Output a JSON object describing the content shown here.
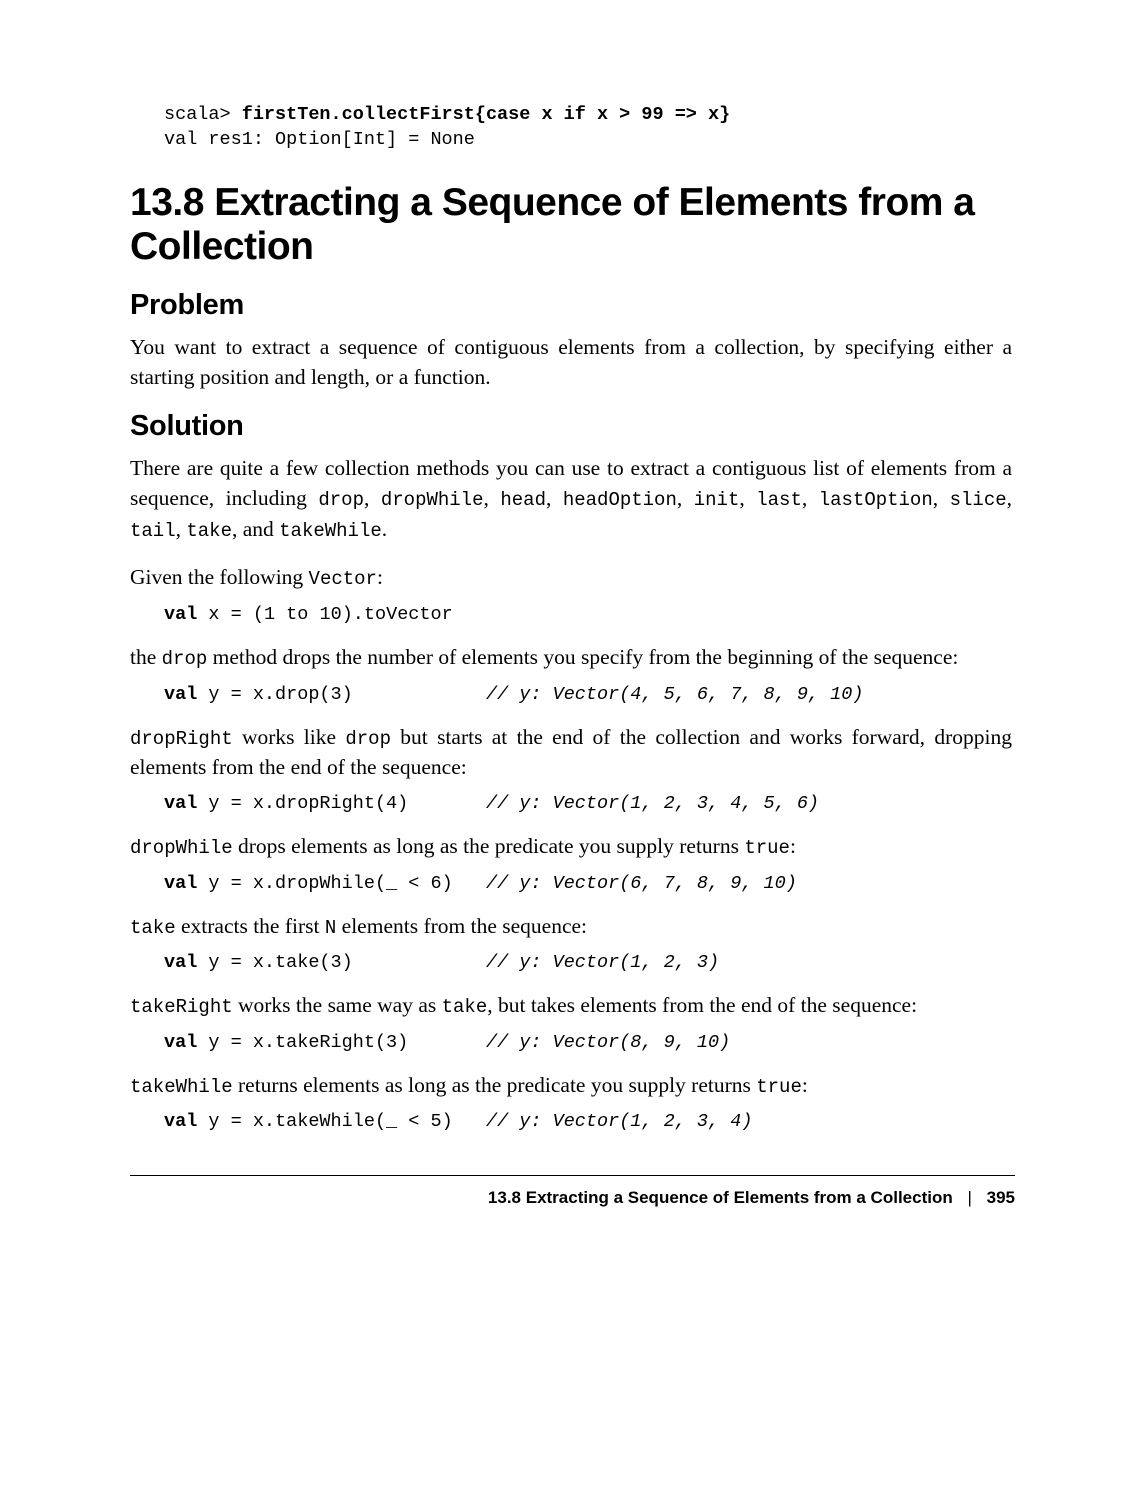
{
  "top_code": {
    "line1_prompt": "scala> ",
    "line1_code": "firstTen.collectFirst{case x if x > 99 => x}",
    "line2": "val res1: Option[Int] = None"
  },
  "section_title": "13.8 Extracting a Sequence of Elements from a Collection",
  "problem_heading": "Problem",
  "problem_text": "You want to extract a sequence of contiguous elements from a collection, by specifying either a starting position and length, or a function.",
  "solution_heading": "Solution",
  "solution_intro_a": "There are quite a few collection methods you can use to extract a contiguous list of elements from a sequence, including ",
  "solution_intro_codes": {
    "c1": "drop",
    "c2": "dropWhile",
    "c3": "head",
    "c4": "headOption",
    "c5": "init",
    "c6": "last",
    "c7": "lastOption",
    "c8": "slice",
    "c9": "tail",
    "c10": "take",
    "c11": "takeWhile"
  },
  "solution_intro_sep": ", ",
  "solution_intro_and": ", and ",
  "solution_intro_end": ".",
  "given_text_a": "Given the following ",
  "given_code": "Vector",
  "given_text_b": ":",
  "code1": {
    "kw": "val",
    "rest_a": " x = (",
    "n1": "1",
    "mid": " to ",
    "n2": "10",
    "rest_b": ").toVector"
  },
  "para_drop_a": "the ",
  "para_drop_code": "drop",
  "para_drop_b": " method drops the number of elements you specify from the beginning of the sequence:",
  "code2": {
    "kw": "val",
    "rest_a": " y = x.drop(",
    "n": "3",
    "rest_b": ")            ",
    "cmt": "// y: Vector(4, 5, 6, 7, 8, 9, 10)"
  },
  "para_dropright_code": "dropRight",
  "para_dropright_a": " works like ",
  "para_dropright_code2": "drop",
  "para_dropright_b": " but starts at the end of the collection and works forward, dropping elements from the end of the sequence:",
  "code3": {
    "kw": "val",
    "rest_a": " y = x.dropRight(",
    "n": "4",
    "rest_b": ")       ",
    "cmt": "// y: Vector(1, 2, 3, 4, 5, 6)"
  },
  "para_dropwhile_code": "dropWhile",
  "para_dropwhile_a": " drops elements as long as the predicate you supply returns ",
  "para_dropwhile_code2": "true",
  "para_dropwhile_b": ":",
  "code4": {
    "kw": "val",
    "rest_a": " y = x.dropWhile(_ < ",
    "n": "6",
    "rest_b": ")   ",
    "cmt": "// y: Vector(6, 7, 8, 9, 10)"
  },
  "para_take_code": "take",
  "para_take_a": " extracts the first ",
  "para_take_code2": "N",
  "para_take_b": " elements from the sequence:",
  "code5": {
    "kw": "val",
    "rest_a": " y = x.take(",
    "n": "3",
    "rest_b": ")            ",
    "cmt": "// y: Vector(1, 2, 3)"
  },
  "para_takeright_code": "takeRight",
  "para_takeright_a": " works the same way as ",
  "para_takeright_code2": "take",
  "para_takeright_b": ", but takes elements from the end of the sequence:",
  "code6": {
    "kw": "val",
    "rest_a": " y = x.takeRight(",
    "n": "3",
    "rest_b": ")       ",
    "cmt": "// y: Vector(8, 9, 10)"
  },
  "para_takewhile_code": "takeWhile",
  "para_takewhile_a": " returns elements as long as the predicate you supply returns ",
  "para_takewhile_code2": "true",
  "para_takewhile_b": ":",
  "code7": {
    "kw": "val",
    "rest_a": " y = x.takeWhile(_ < ",
    "n": "5",
    "rest_b": ")   ",
    "cmt": "// y: Vector(1, 2, 3, 4)"
  },
  "footer": {
    "title": "13.8 Extracting a Sequence of Elements from a Collection",
    "sep": "|",
    "page": "395"
  }
}
